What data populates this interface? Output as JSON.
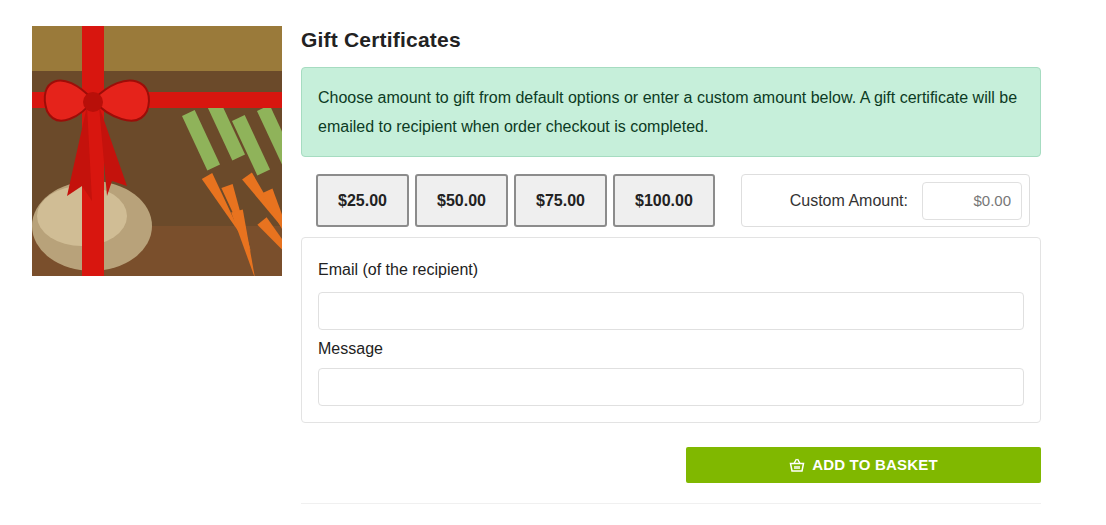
{
  "title": "Gift Certificates",
  "notice": "Choose amount to gift from default options or enter a custom amount below. A gift certificate will be emailed to recipient when order checkout is completed.",
  "amounts": [
    {
      "label": "$25.00",
      "selected": false
    },
    {
      "label": "$50.00",
      "selected": false
    },
    {
      "label": "$75.00",
      "selected": false
    },
    {
      "label": "$100.00",
      "selected": false
    }
  ],
  "custom_amount": {
    "label": "Custom Amount:",
    "placeholder": "$0.00"
  },
  "form": {
    "email_label": "Email (of the recipient)",
    "message_label": "Message"
  },
  "button": "ADD TO BASKET"
}
